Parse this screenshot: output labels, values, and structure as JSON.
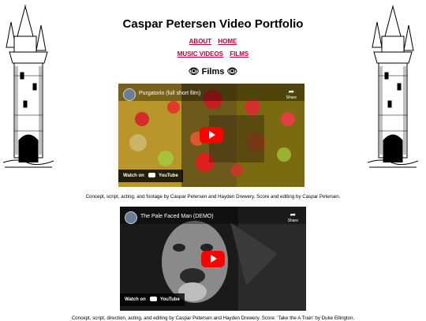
{
  "header": {
    "title": "Caspar Petersen Video Portfolio"
  },
  "nav": {
    "about": "ABOUT",
    "home": "HOME",
    "music_videos": "MUSIC VIDEOS",
    "films": "FILMS"
  },
  "section": {
    "heading": "Films",
    "eye_glyph": "👁"
  },
  "videos": [
    {
      "title": "Purgatorio (full short film)",
      "watch_on": "Watch on",
      "youtube": "YouTube",
      "share": "Share",
      "caption": "Concept, script, acting, and footage by Caspar Petersen and Hayden Drewery. Score and editing by Caspar Petersen."
    },
    {
      "title": "The Pale Faced Man (DEMO)",
      "watch_on": "Watch on",
      "youtube": "YouTube",
      "share": "Share",
      "caption": "Concept, script, direction, acting, and editing by Caspar Petersen and Hayden Drewery. Score: 'Take the A Train' by Duke Ellington."
    }
  ],
  "colors": {
    "link": "#c00033",
    "play": "#ff0000"
  }
}
